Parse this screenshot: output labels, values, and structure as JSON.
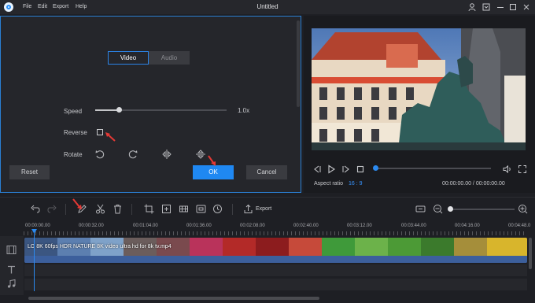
{
  "menu": [
    "File",
    "Edit",
    "Export",
    "Help"
  ],
  "window_title": "Untitled",
  "tabs": {
    "video": "Video",
    "audio": "Audio"
  },
  "speed": {
    "label": "Speed",
    "value": "1.0x",
    "level": 0.18
  },
  "reverse": {
    "label": "Reverse",
    "checked": false
  },
  "rotate": {
    "label": "Rotate"
  },
  "buttons": {
    "reset": "Reset",
    "ok": "OK",
    "cancel": "Cancel"
  },
  "player": {
    "aspect_label": "Aspect ratio",
    "aspect_value": "16 : 9",
    "time": "00:00:00.00 / 00:00:00.00",
    "progress": 0
  },
  "toolbar": {
    "export": "Export"
  },
  "ruler": [
    "00:00:00.00",
    "00:00:32.00",
    "00:01:04.00",
    "00:01:36.00",
    "00:02:08.00",
    "00:02:40.00",
    "00:03:12.00",
    "00:03:44.00",
    "00:04:16.00",
    "00:04:48.0"
  ],
  "clip": {
    "label": "LG 8K 60fps HDR NATURE 8K video ultra hd for 8k tv.mp4"
  },
  "colors": {
    "accent": "#1f88f2",
    "annotation_arrow": "#e53935"
  },
  "icons": [
    "app-logo",
    "user-icon",
    "restore-icon",
    "minimize-icon",
    "maximize-icon",
    "close-icon",
    "rotate-left-icon",
    "rotate-right-icon",
    "flip-horizontal-icon",
    "flip-vertical-icon",
    "undo-icon",
    "redo-icon",
    "edit-pencil-icon",
    "scissors-icon",
    "trash-icon",
    "crop-icon",
    "effect-icon",
    "mosaic-icon",
    "watermark-icon",
    "timer-icon",
    "export-icon",
    "fit-icon",
    "zoom-out-icon",
    "zoom-in-icon",
    "video-track-icon",
    "text-track-icon",
    "audio-track-icon",
    "prev-frame-icon",
    "play-icon",
    "next-frame-icon",
    "stop-icon",
    "volume-icon",
    "fullscreen-icon",
    "red-arrow-annotation"
  ]
}
